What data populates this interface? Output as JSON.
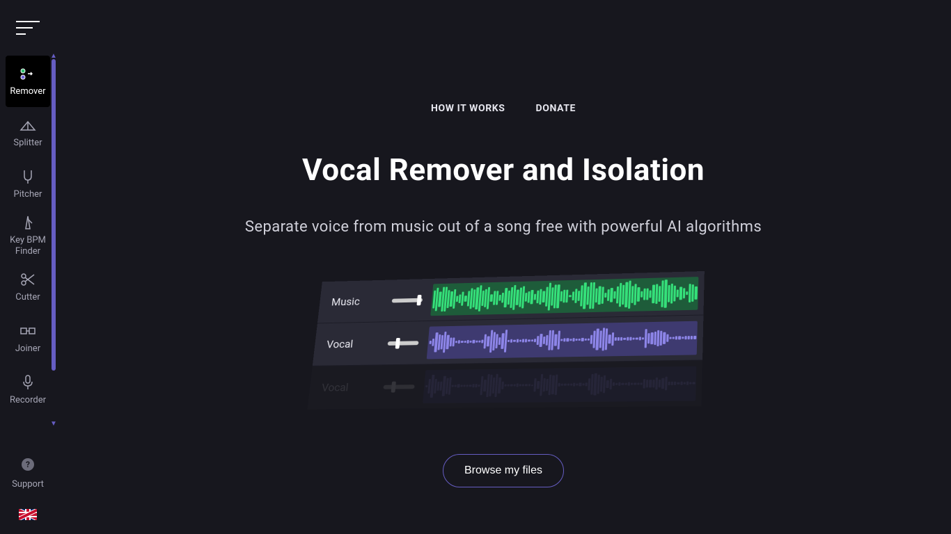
{
  "sidebar": {
    "items": [
      {
        "label": "Remover"
      },
      {
        "label": "Splitter"
      },
      {
        "label": "Pitcher"
      },
      {
        "label": "Key BPM Finder"
      },
      {
        "label": "Cutter"
      },
      {
        "label": "Joiner"
      },
      {
        "label": "Recorder"
      }
    ],
    "support_label": "Support"
  },
  "header": {
    "how_it_works": "HOW IT WORKS",
    "donate": "DONATE"
  },
  "hero": {
    "title": "Vocal Remover and Isolation",
    "subtitle": "Separate voice from music out of a song free with powerful AI algorithms",
    "track_music_label": "Music",
    "track_vocal_label": "Vocal",
    "track_vocal_reflection_label": "Vocal",
    "browse_label": "Browse my files"
  },
  "colors": {
    "accent": "#665dc3",
    "wave_green": "#35e07a",
    "wave_purple": "#8d85e8",
    "bg": "#17171e"
  }
}
